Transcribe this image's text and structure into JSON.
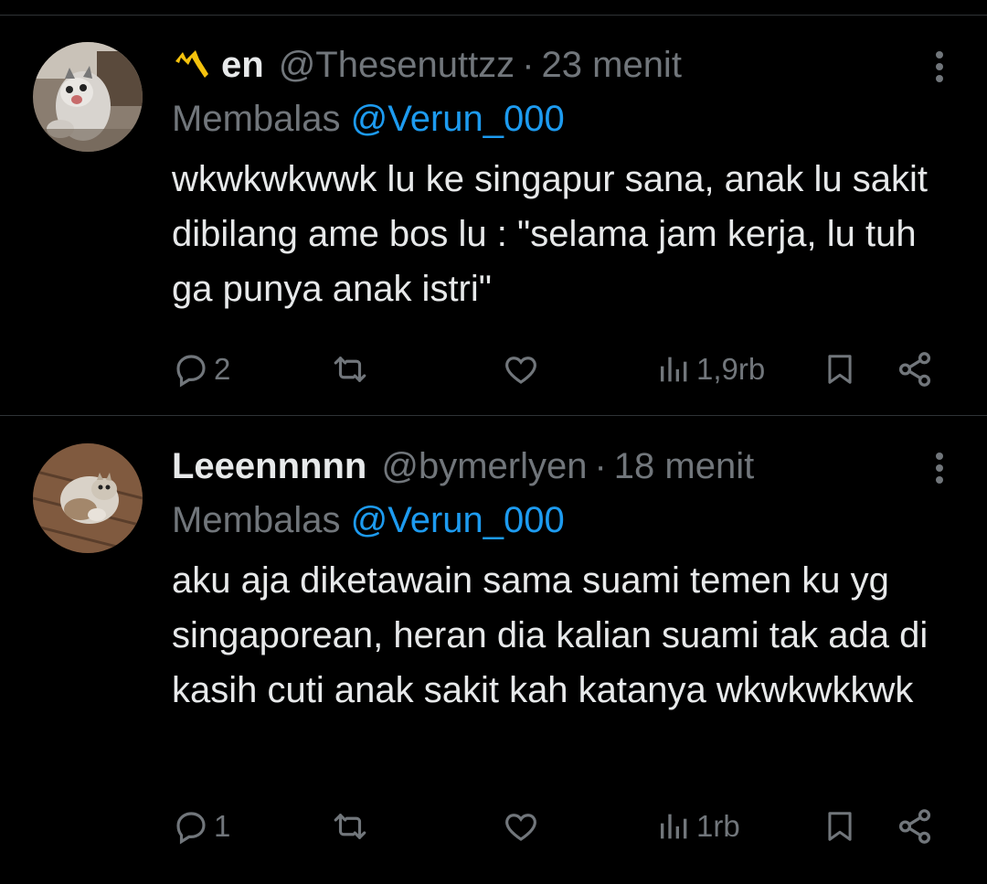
{
  "tweets": [
    {
      "name": "en",
      "handle": "@Thesenuttzz",
      "separator": "·",
      "time": "23 menit",
      "reply_prefix": "Membalas",
      "reply_mention": "@Verun_000",
      "text": "wkwkwkwwk lu ke singapur sana, anak lu sakit dibilang ame bos lu : \"selama jam kerja, lu tuh ga punya anak istri\"",
      "replies": "2",
      "views": "1,9rb",
      "avatar_icon": "cat-avatar",
      "name_emoji_color": "#f4c20d"
    },
    {
      "name": "Leeennnnn",
      "handle": "@bymerlyen",
      "separator": "·",
      "time": "18 menit",
      "reply_prefix": "Membalas",
      "reply_mention": "@Verun_000",
      "text": "aku aja diketawain sama suami temen ku yg singaporean, heran dia kalian suami tak ada di kasih cuti anak sakit kah katanya wkwkwkkwk",
      "replies": "1",
      "views": "1rb",
      "avatar_icon": "cat-avatar"
    }
  ],
  "colors": {
    "background": "#000000",
    "text": "#e7e9ea",
    "secondary": "#71767b",
    "mention": "#1d9bf0",
    "divider": "#2f3336"
  }
}
